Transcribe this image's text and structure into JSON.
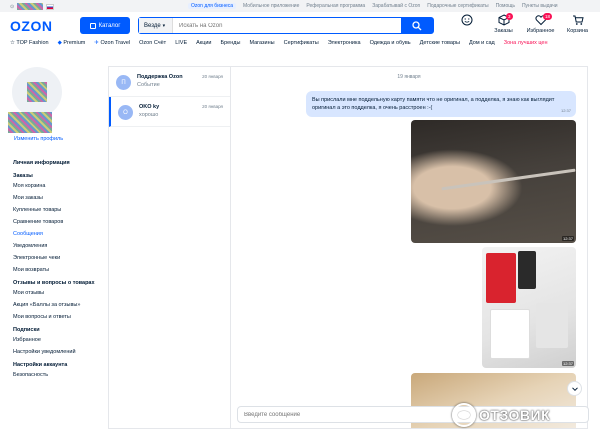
{
  "top_strip": {
    "links": [
      "Ozon для бизнеса",
      "Мобильное приложение",
      "Реферальная программа",
      "Зарабатывай с Ozon",
      "Подарочные сертификаты",
      "Помощь",
      "Пункты выдачи"
    ]
  },
  "header": {
    "logo": "OZON",
    "catalog_label": "Каталог",
    "search_scope": "Везде",
    "search_placeholder": "Искать на Ozon",
    "icons": [
      {
        "icon": "smile-icon",
        "label": "",
        "badge": ""
      },
      {
        "icon": "box-icon",
        "label": "Заказы",
        "badge": "3"
      },
      {
        "icon": "heart-icon",
        "label": "Избранное",
        "badge": "18"
      },
      {
        "icon": "cart-icon",
        "label": "Корзина",
        "badge": ""
      }
    ]
  },
  "nav": [
    "TOP Fashion",
    "Premium",
    "Ozon Travel",
    "Ozon Счёт",
    "LIVE",
    "Акции",
    "Бренды",
    "Магазины",
    "Сертификаты",
    "Электроника",
    "Одежда и обувь",
    "Детские товары",
    "Дом и сад",
    "Зона лучших цен"
  ],
  "sidebar": {
    "edit_profile": "Изменить профиль",
    "sections": [
      {
        "head": "Личная информация",
        "items": []
      },
      {
        "head": "Заказы",
        "items": [
          "Моя корзина",
          "Мои заказы",
          "Купленные товары",
          "Сравнение товаров",
          "Сообщения",
          "Уведомления",
          "Электронные чеки",
          "Мои возвраты"
        ]
      },
      {
        "head": "Отзывы и вопросы о товарах",
        "items": [
          "Мои отзывы",
          "Акция «Баллы за отзывы»",
          "Мои вопросы и ответы"
        ]
      },
      {
        "head": "Подписки",
        "items": [
          "Избранное",
          "Настройки уведомлений"
        ]
      },
      {
        "head": "Настройки аккаунта",
        "items": [
          "Безопасность"
        ]
      }
    ],
    "active_item": "Сообщения"
  },
  "chats": [
    {
      "avatar_letter": "П",
      "name": "Поддержка Ozon",
      "preview": "Событие",
      "date": "20 января",
      "active": false
    },
    {
      "avatar_letter": "O",
      "name": "OKO ky",
      "preview": "хорошо",
      "date": "20 января",
      "active": true
    }
  ],
  "conversation": {
    "day_label": "19 января",
    "message_text": "Вы прислали мне поддельную карту памяти что не оригинал, а подделка, я знаю как выглядит оригинал а это подделка, я очень расстроен :-(",
    "message_time": "12:37",
    "photo_times": [
      "12:37",
      "12:37"
    ],
    "input_placeholder": "Введите сообщение"
  },
  "watermark": "ОТЗОВИК",
  "colors": {
    "accent": "#005bff",
    "badge": "#f91155",
    "bubble": "#d8e6ff"
  }
}
